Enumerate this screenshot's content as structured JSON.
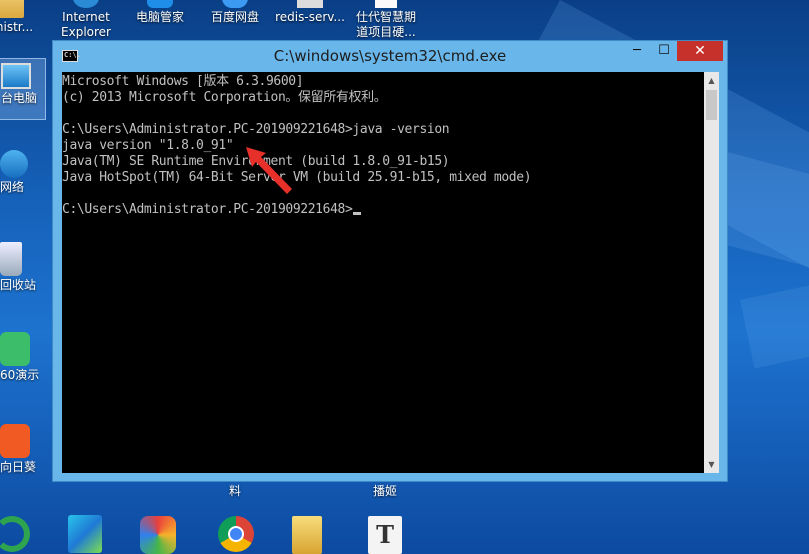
{
  "desktop": {
    "icons_top": [
      {
        "label": "ministr...",
        "name": "administrator-folder-icon"
      },
      {
        "label": "Internet Explorer",
        "name": "internet-explorer-icon"
      },
      {
        "label": "电脑管家",
        "name": "pc-manager-icon"
      },
      {
        "label": "百度网盘",
        "name": "baidu-netdisk-icon"
      },
      {
        "label": "redis-serv...",
        "name": "redis-server-icon"
      },
      {
        "label": "仕代智慧期道项目硬...",
        "name": "project-folder-icon"
      }
    ],
    "icons_left": [
      {
        "label": "台电脑",
        "name": "this-pc-icon"
      },
      {
        "label": "网络",
        "name": "network-icon"
      },
      {
        "label": "回收站",
        "name": "recycle-bin-icon"
      },
      {
        "label": "60演示",
        "name": "presentation-app-icon"
      },
      {
        "label": "向日葵",
        "name": "sunflower-remote-icon"
      }
    ],
    "icons_bottom_row": [
      {
        "label": "料",
        "name": "materials-folder-icon"
      },
      {
        "label": "播姬",
        "name": "boji-app-icon"
      }
    ],
    "icons_bottom": [
      {
        "name": "green-app-icon"
      },
      {
        "name": "intellij-idea-icon"
      },
      {
        "name": "colorful-app-icon"
      },
      {
        "name": "chrome-icon"
      },
      {
        "name": "folder-icon"
      },
      {
        "name": "typora-icon"
      }
    ]
  },
  "window": {
    "title": "C:\\windows\\system32\\cmd.exe",
    "icon_text": "C:\\.",
    "min_label": "─",
    "max_label": "☐",
    "close_label": "✕"
  },
  "console": {
    "lines": [
      "Microsoft Windows [版本 6.3.9600]",
      "(c) 2013 Microsoft Corporation。保留所有权利。",
      "",
      "C:\\Users\\Administrator.PC-201909221648>java -version",
      "java version \"1.8.0_91\"",
      "Java(TM) SE Runtime Environment (build 1.8.0_91-b15)",
      "Java HotSpot(TM) 64-Bit Server VM (build 25.91-b15, mixed mode)",
      "",
      "C:\\Users\\Administrator.PC-201909221648>"
    ]
  },
  "colors": {
    "console_bg": "#000000",
    "console_text": "#c0c0c0",
    "close_button": "#c7312b",
    "annotation_arrow": "#e8302a"
  }
}
